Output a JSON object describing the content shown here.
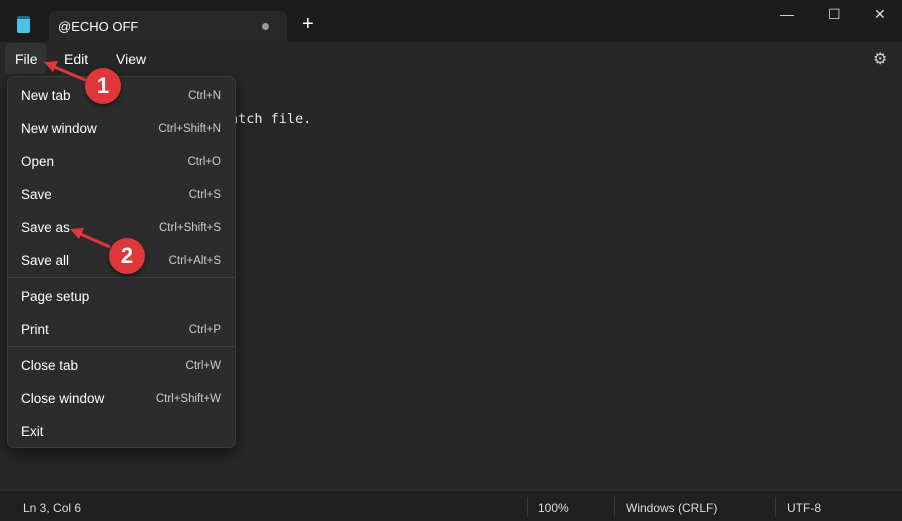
{
  "tab": {
    "title": "@ECHO OFF",
    "new_tab": "+"
  },
  "window_controls": {
    "minimize": "—",
    "maximize": "☐",
    "close": "✕"
  },
  "menubar": {
    "file": "File",
    "edit": "Edit",
    "view": "View",
    "settings": "⚙"
  },
  "editor": {
    "visible_text": "atch file."
  },
  "file_menu": [
    {
      "label": "New tab",
      "shortcut": "Ctrl+N"
    },
    {
      "label": "New window",
      "shortcut": "Ctrl+Shift+N"
    },
    {
      "label": "Open",
      "shortcut": "Ctrl+O"
    },
    {
      "label": "Save",
      "shortcut": "Ctrl+S"
    },
    {
      "label": "Save as",
      "shortcut": "Ctrl+Shift+S"
    },
    {
      "label": "Save all",
      "shortcut": "Ctrl+Alt+S"
    },
    {
      "label": "Page setup",
      "shortcut": ""
    },
    {
      "label": "Print",
      "shortcut": "Ctrl+P"
    },
    {
      "label": "Close tab",
      "shortcut": "Ctrl+W"
    },
    {
      "label": "Close window",
      "shortcut": "Ctrl+Shift+W"
    },
    {
      "label": "Exit",
      "shortcut": ""
    }
  ],
  "status": {
    "position": "Ln 3, Col 6",
    "zoom": "100%",
    "line_ending": "Windows (CRLF)",
    "encoding": "UTF-8"
  },
  "annotations": {
    "step1": "1",
    "step2": "2",
    "color": "#e0383a"
  }
}
